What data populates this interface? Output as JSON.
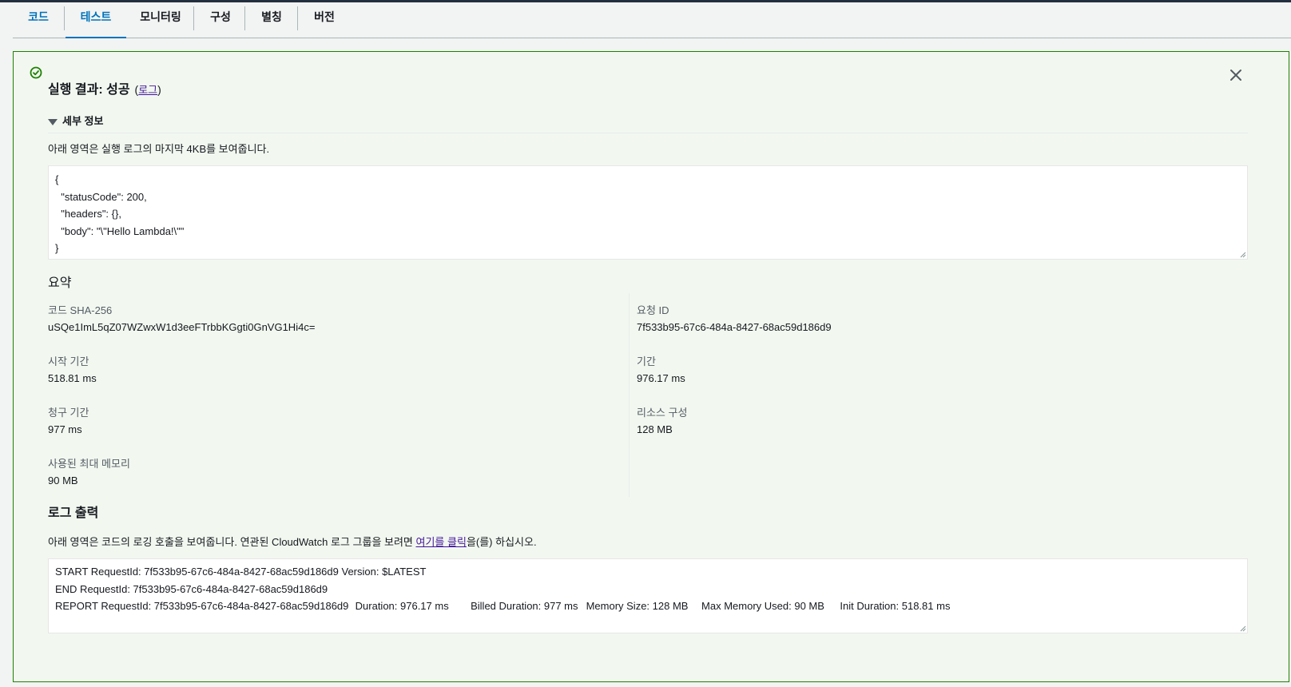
{
  "tabs": [
    {
      "label": "코드"
    },
    {
      "label": "테스트"
    },
    {
      "label": "모니터링"
    },
    {
      "label": "구성"
    },
    {
      "label": "별칭"
    },
    {
      "label": "버전"
    }
  ],
  "active_tab": "테스트",
  "result": {
    "title": "실행 결과: 성공",
    "log_link": "로그",
    "status_color": "#1d8102"
  },
  "details": {
    "toggle_label": "세부 정보",
    "description": "아래 영역은 실행 로그의 마지막 4KB를 보여줍니다.",
    "output": "{\n  \"statusCode\": 200,\n  \"headers\": {},\n  \"body\": \"\\\"Hello Lambda!\\\"\"\n}"
  },
  "summary": {
    "heading": "요약",
    "code_sha_label": "코드 SHA-256",
    "code_sha": "uSQe1ImL5qZ07WZwxW1d3eeFTrbbKGgti0GnVG1Hi4c=",
    "request_id_label": "요청 ID",
    "request_id": "7f533b95-67c6-484a-8427-68ac59d186d9",
    "init_duration_label": "시작 기간",
    "init_duration": "518.81 ms",
    "duration_label": "기간",
    "duration": "976.17 ms",
    "billed_duration_label": "청구 기간",
    "billed_duration": "977 ms",
    "resources_label": "리소스 구성",
    "resources": "128 MB",
    "max_memory_label": "사용된 최대 메모리",
    "max_memory": "90 MB"
  },
  "log_output": {
    "heading": "로그 출력",
    "desc_before": "아래 영역은 코드의 로깅 호출을 보여줍니다. 연관된 CloudWatch 로그 그룹을 보려면 ",
    "desc_link": "여기를 클릭",
    "desc_after": "을(를) 하십시오.",
    "log_text": "START RequestId: 7f533b95-67c6-484a-8427-68ac59d186d9 Version: $LATEST\nEND RequestId: 7f533b95-67c6-484a-8427-68ac59d186d9\nREPORT RequestId: 7f533b95-67c6-484a-8427-68ac59d186d9\tDuration: 976.17 ms\tBilled Duration: 977 ms\tMemory Size: 128 MB\tMax Memory Used: 90 MB\tInit Duration: 518.81 ms"
  },
  "icons": {
    "success": "check-circle-icon",
    "close": "close-icon"
  }
}
